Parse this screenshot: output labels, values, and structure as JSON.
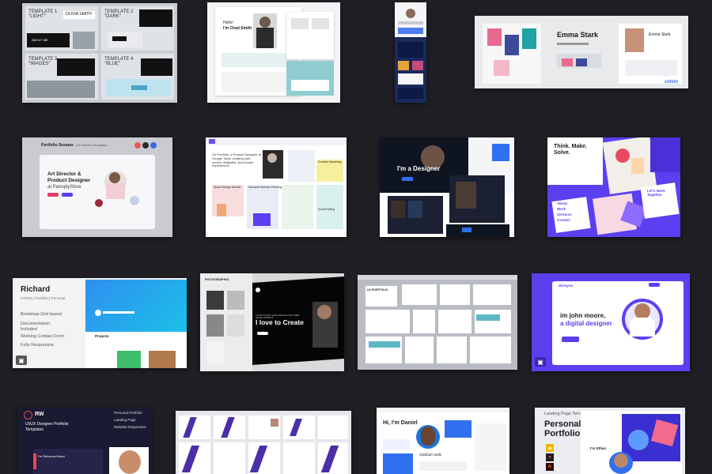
{
  "templates_card": {
    "t1": "TEMPLATE 1\n\"LIGHT\"",
    "t2": "TEMPLATE 2\n\"DARK\"",
    "t3": "TEMPLATE 3\n\"IMAGES\"",
    "t4": "TEMPLATE 4\n\"BLUE\"",
    "name": "OLIVIA SMITH",
    "about": "ABOUT ME"
  },
  "hello_card": {
    "line1": "Hello!",
    "line2": "I'm Chad Smith"
  },
  "emma_card": {
    "name": "Emma Stark",
    "name2": "Emma Stark",
    "badge": "zolvin"
  },
  "panoply_card": {
    "brand": "Portfolio Sesame",
    "subtitle": "Art Director Templates",
    "headline1": "Art Director &",
    "headline2": "Product Designer",
    "headline3": "at PanoplyStore"
  },
  "portfolio_card": {
    "intro": "I'm Portfolio, a Product Designer at Google Tokyo creating user-centric, delightful, and human experiences.",
    "tiles": [
      "Space Design Service",
      "Microsoft Website Planning",
      "Creative Marketing",
      "Social Selling"
    ]
  },
  "designer_card": {
    "title": "I'm a Designer"
  },
  "think_card": {
    "headline": "Think. Make. Solve.",
    "menu": [
      "About",
      "Work",
      "Services",
      "Contact"
    ],
    "right": "Let's Work Together"
  },
  "richard_card": {
    "name": "Richard",
    "subtitle": "HTML5 | Portfolio | Personal",
    "features": [
      "Bootstrap Grid based",
      "Documentation Included",
      "Working Contact Form",
      "Fully Responsive"
    ],
    "section": "Projects"
  },
  "create_card": {
    "brand": "PICTOGRAPHIC",
    "headline": "I love to Create",
    "kicker": "YOUR STORY WITH DESIGN AND WEB DEVELOPMENT"
  },
  "screens_card": {
    "label": "UX PORTFOLIO"
  },
  "moore_card": {
    "brand": "divisyon",
    "line1": "im john moore,",
    "line2": "a digital designer",
    "button": "Hire Me"
  },
  "rw_card": {
    "logo": "RW",
    "title": "UI/UX Designer Portfolio Templates",
    "list": [
      "Personal Portfolio",
      "Landing Page",
      "Website Responsive"
    ],
    "hello": "I'm Rebecca Wood"
  },
  "daniel_card": {
    "title": "Hi, I'm Daniel",
    "name": "Siddhart Sethi"
  },
  "landing_card": {
    "kicker": "Landing Page Template",
    "title1": "Personal",
    "title2": "Portfolio",
    "person": "I'm Ethan"
  },
  "colors": {
    "background": "#1f1f24",
    "purple": "#5b3ff0",
    "blue": "#2f6ff0"
  }
}
